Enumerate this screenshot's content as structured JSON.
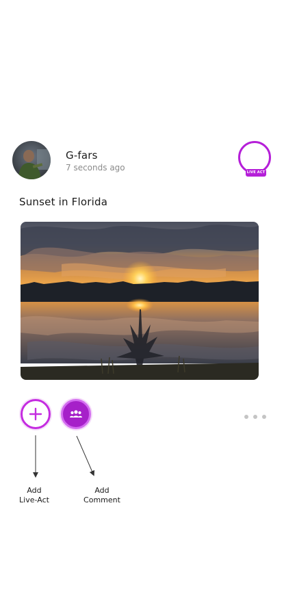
{
  "post": {
    "author": {
      "name": "G-fars",
      "timestamp": "7 seconds ago",
      "avatar_icon": "user-avatar"
    },
    "live_badge": "LIVE ACT",
    "caption": "Sunset in Florida",
    "photo_icon": "sunset-photo"
  },
  "actions": {
    "add_icon": "plus-icon",
    "comment_icon": "group-icon",
    "more_icon": "more-horizontal-icon"
  },
  "annotations": {
    "add_line1": "Add",
    "add_line2": "Live-Act",
    "comment_line1": "Add",
    "comment_line2": "Comment"
  },
  "colors": {
    "accent": "#b51fd8",
    "accent_dark": "#a620c9",
    "muted_text": "#8a8a8a"
  }
}
